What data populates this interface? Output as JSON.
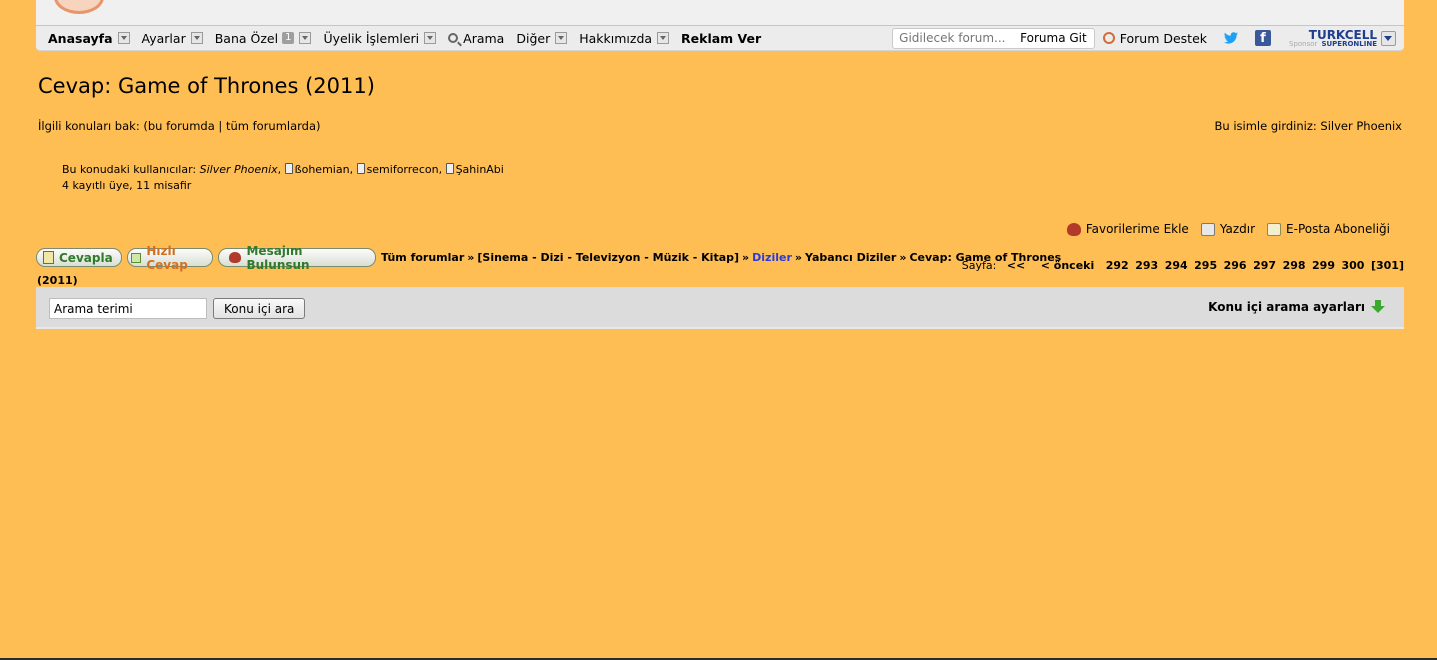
{
  "nav": {
    "home": "Anasayfa",
    "settings": "Ayarlar",
    "special": "Bana Özel",
    "special_badge": "1",
    "membership": "Üyelik İşlemleri",
    "search": "Arama",
    "other": "Diğer",
    "about": "Hakkımızda",
    "advertise": "Reklam Ver",
    "goto_placeholder": "Gidilecek forum...",
    "goto_button": "Foruma Git",
    "support": "Forum Destek",
    "sponsor_brand": "TURKCELL",
    "sponsor_label": "Sponsor",
    "sponsor_sub": "SUPERONLINE"
  },
  "page": {
    "title": "Cevap: Game of Thrones (2011)",
    "related_prefix": "İlgili konuları bak: (",
    "related_this_forum": "bu forumda",
    "related_separator": " | ",
    "related_all_forums": "tüm forumlarda",
    "related_suffix": ")",
    "logged_in_as": "Bu isimle girdiniz: Silver Phoenix"
  },
  "users": {
    "prefix": "Bu konudaki kullanıcılar:",
    "current_user": "Silver Phoenix",
    "members": [
      "ßohemian",
      "semiforrecon",
      "ŞahinAbi"
    ],
    "summary": "4 kayıtlı üye, 11 misafir"
  },
  "actions": {
    "favorite": "Favorilerime Ekle",
    "print": "Yazdır",
    "subscribe": "E-Posta Aboneliği"
  },
  "buttons": {
    "reply": "Cevapla",
    "quick_reply": "Hızlı Cevap",
    "found": "Mesajım Bulunsun"
  },
  "breadcrumb": {
    "all": "Tüm forumlar",
    "sep": "»",
    "category": "[Sinema - Dizi - Televizyon - Müzik - Kitap]",
    "forum": "Diziler",
    "subforum": "Yabancı Diziler",
    "topic": "Cevap: Game of Thrones",
    "topic_wrap": "(2011)"
  },
  "pagination": {
    "label": "Sayfa:",
    "first": "<<",
    "prev": "< önceki",
    "pages": [
      "292",
      "293",
      "294",
      "295",
      "296",
      "297",
      "298",
      "299",
      "300",
      "[301]"
    ]
  },
  "search": {
    "value": "Arama terimi",
    "button": "Konu içi ara",
    "settings": "Konu içi arama ayarları"
  }
}
